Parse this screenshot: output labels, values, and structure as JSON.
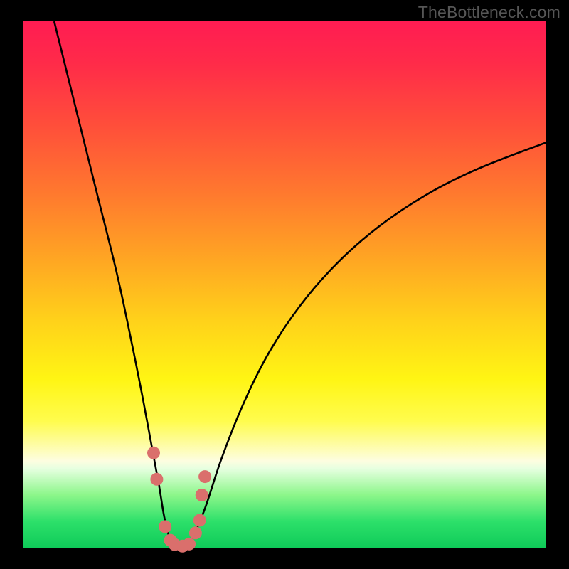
{
  "watermark": "TheBottleneck.com",
  "chart_data": {
    "type": "line",
    "title": "",
    "xlabel": "",
    "ylabel": "",
    "xlim": [
      0,
      100
    ],
    "ylim": [
      0,
      100
    ],
    "series": [
      {
        "name": "bottleneck-curve",
        "x": [
          6,
          10,
          14,
          18,
          21,
          23,
          24.5,
          26,
          27,
          28,
          29,
          30,
          31,
          32,
          33,
          35,
          38,
          42,
          47,
          53,
          60,
          68,
          77,
          87,
          100
        ],
        "values": [
          100,
          84,
          68,
          52,
          38,
          28,
          20,
          12,
          6,
          2,
          0.5,
          0,
          0.2,
          1,
          3,
          8,
          17,
          27,
          37,
          46,
          54,
          61,
          67,
          72,
          77
        ]
      }
    ],
    "markers": {
      "name": "highlight-points",
      "color": "#da6f6c",
      "points": [
        {
          "x": 25.0,
          "y": 18.0
        },
        {
          "x": 25.6,
          "y": 13.0
        },
        {
          "x": 27.2,
          "y": 4.0
        },
        {
          "x": 28.2,
          "y": 1.4
        },
        {
          "x": 29.0,
          "y": 0.6
        },
        {
          "x": 30.5,
          "y": 0.3
        },
        {
          "x": 31.8,
          "y": 0.7
        },
        {
          "x": 33.0,
          "y": 2.8
        },
        {
          "x": 33.8,
          "y": 5.2
        },
        {
          "x": 34.2,
          "y": 10.0
        },
        {
          "x": 34.8,
          "y": 13.5
        }
      ]
    }
  }
}
